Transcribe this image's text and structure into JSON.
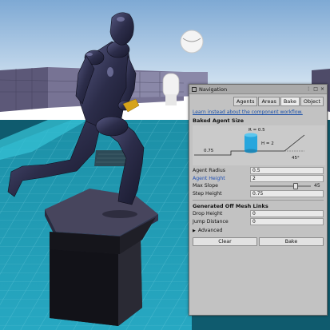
{
  "panel": {
    "title": "Navigation",
    "window_controls": [
      "⋮",
      "□",
      "×"
    ],
    "tabs": [
      {
        "label": "Agents",
        "active": false
      },
      {
        "label": "Areas",
        "active": false
      },
      {
        "label": "Bake",
        "active": true
      },
      {
        "label": "Object",
        "active": false
      }
    ],
    "link_text": "Learn instead about the component workflow.",
    "baked_agent_size": {
      "heading": "Baked Agent Size",
      "diagram": {
        "radius_label": "R = 0.5",
        "height_label": "H = 2",
        "step_label": "0.75",
        "slope_label": "45°"
      },
      "fields": [
        {
          "label": "Agent Radius",
          "value": "0.5",
          "highlight": false
        },
        {
          "label": "Agent Height",
          "value": "2",
          "highlight": true
        }
      ],
      "max_slope": {
        "label": "Max Slope",
        "value": "45",
        "fraction": 0.75
      },
      "step_height": {
        "label": "Step Height",
        "value": "0.75"
      }
    },
    "offmesh": {
      "heading": "Generated Off Mesh Links",
      "fields": [
        {
          "label": "Drop Height",
          "value": "0"
        },
        {
          "label": "Jump Distance",
          "value": "0"
        }
      ]
    },
    "advanced": {
      "label": "Advanced",
      "arrow": "▶"
    },
    "buttons": {
      "clear": "Clear",
      "bake": "Bake"
    }
  },
  "colors": {
    "sky_top": "#7ea9d4",
    "sky_bottom": "#d3e3f1",
    "navmesh": "#2fb4c8",
    "robot": "#2a2a42",
    "panel_bg": "#c2c2c2",
    "link": "#1a4fa8",
    "agent_cylinder": "#27a6dd"
  }
}
